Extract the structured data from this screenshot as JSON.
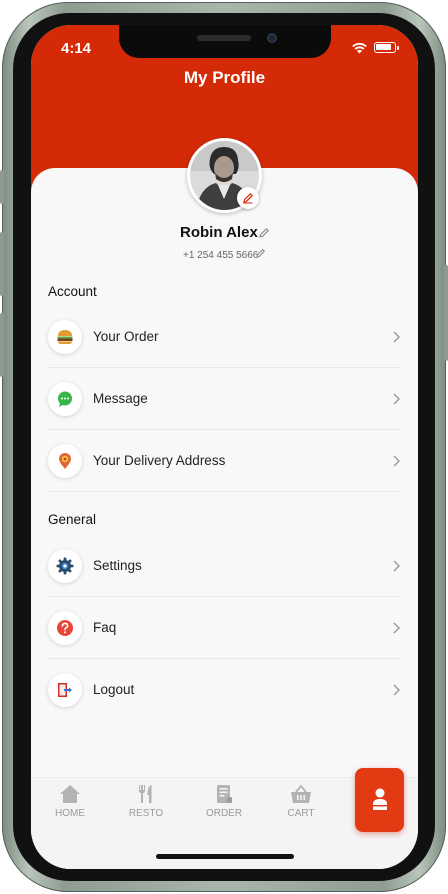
{
  "status_bar": {
    "time": "4:14"
  },
  "header": {
    "title": "My Profile"
  },
  "profile": {
    "name": "Robin Alex",
    "phone": "+1 254 455 5666"
  },
  "sections": [
    {
      "title": "Account",
      "items": [
        {
          "label": "Your Order",
          "icon": "burger-icon"
        },
        {
          "label": "Message",
          "icon": "chat-bubble-icon"
        },
        {
          "label": "Your Delivery Address",
          "icon": "map-pin-icon"
        }
      ]
    },
    {
      "title": "General",
      "items": [
        {
          "label": "Settings",
          "icon": "gear-icon"
        },
        {
          "label": "Faq",
          "icon": "question-icon"
        },
        {
          "label": "Logout",
          "icon": "logout-icon"
        }
      ]
    }
  ],
  "bottom_nav": {
    "items": [
      {
        "label": "HOME",
        "icon": "home-icon"
      },
      {
        "label": "RESTO",
        "icon": "fork-knife-icon"
      },
      {
        "label": "ORDER",
        "icon": "receipt-icon"
      },
      {
        "label": "CART",
        "icon": "basket-icon"
      }
    ],
    "active": {
      "icon": "user-icon"
    }
  },
  "colors": {
    "accent": "#d42a07",
    "background": "#f8f8f8",
    "nav_inactive": "#9a9a9a"
  }
}
